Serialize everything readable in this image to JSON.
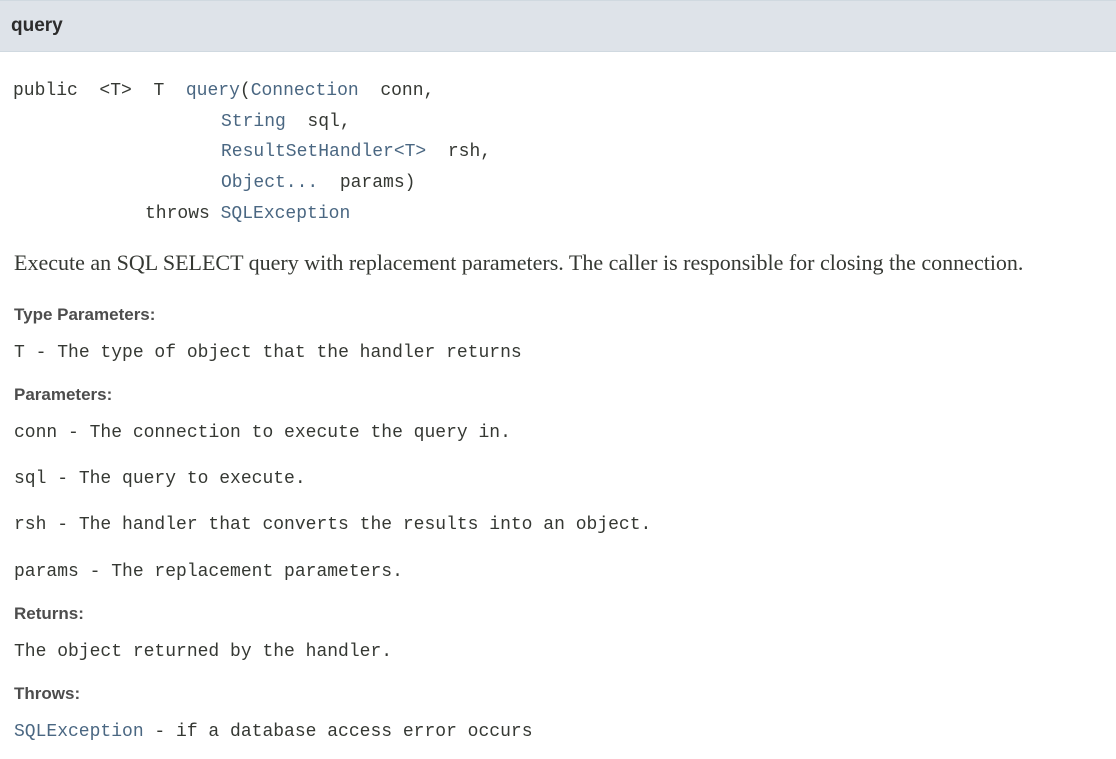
{
  "header": {
    "title": "query"
  },
  "signature": {
    "modifier": "public",
    "type_param": "<T>",
    "return_type": "T",
    "method_name": "query",
    "open_paren": "(",
    "param1_type": "Connection",
    "param1_name": "conn,",
    "param2_type": "String",
    "param2_name": "sql,",
    "param3_type": "ResultSetHandler<T>",
    "param3_name": "rsh,",
    "param4_type": "Object...",
    "param4_name": "params)",
    "throws_keyword": "throws",
    "exception_type": "SQLException"
  },
  "description": "Execute an SQL SELECT query with replacement parameters. The caller is responsible for closing the connection.",
  "type_parameters": {
    "label": "Type Parameters:",
    "items": [
      {
        "name": "T",
        "dash": " - ",
        "text": "The type of object that the handler returns"
      }
    ]
  },
  "parameters": {
    "label": "Parameters:",
    "items": [
      {
        "name": "conn",
        "dash": " - ",
        "text": "The connection to execute the query in."
      },
      {
        "name": "sql",
        "dash": " - ",
        "text": "The query to execute."
      },
      {
        "name": "rsh",
        "dash": " - ",
        "text": "The handler that converts the results into an object."
      },
      {
        "name": "params",
        "dash": " - ",
        "text": "The replacement parameters."
      }
    ]
  },
  "returns": {
    "label": "Returns:",
    "text": "The object returned by the handler."
  },
  "throws": {
    "label": "Throws:",
    "exception": "SQLException",
    "dash": " - ",
    "text": "if a database access error occurs"
  },
  "colors": {
    "header_bg": "#dee3e9",
    "link": "#4a6782",
    "text": "#353833"
  }
}
